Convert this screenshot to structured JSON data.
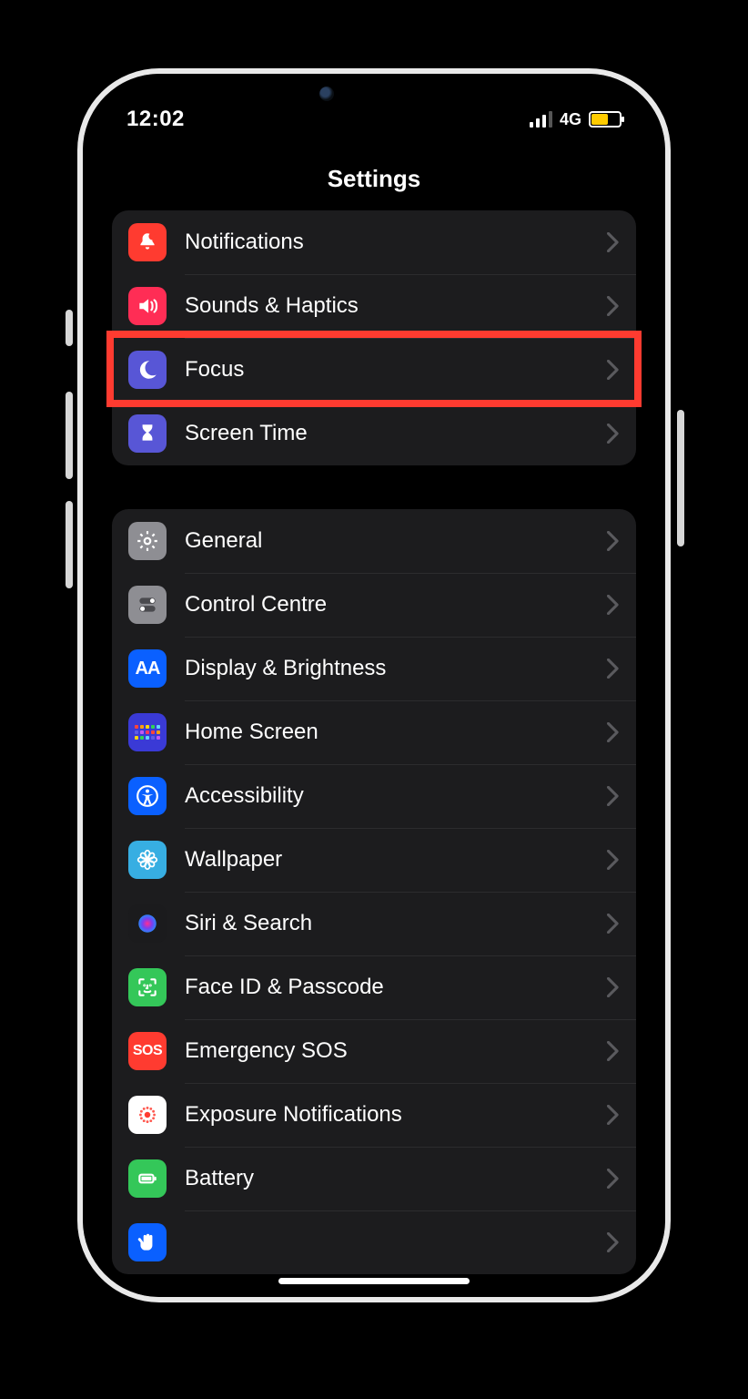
{
  "status": {
    "time": "12:02",
    "network": "4G"
  },
  "title": "Settings",
  "highlighted_index": [
    0,
    2
  ],
  "groups": [
    {
      "rows": [
        {
          "id": "notifications",
          "label": "Notifications",
          "icon": "bell-icon",
          "bg": "#ff3b30"
        },
        {
          "id": "sounds",
          "label": "Sounds & Haptics",
          "icon": "speaker-icon",
          "bg": "#ff2d55"
        },
        {
          "id": "focus",
          "label": "Focus",
          "icon": "moon-icon",
          "bg": "#5856d6"
        },
        {
          "id": "screentime",
          "label": "Screen Time",
          "icon": "hourglass-icon",
          "bg": "#5856d6"
        }
      ]
    },
    {
      "rows": [
        {
          "id": "general",
          "label": "General",
          "icon": "gear-icon",
          "bg": "#8e8e93"
        },
        {
          "id": "controlcentre",
          "label": "Control Centre",
          "icon": "switches-icon",
          "bg": "#8e8e93"
        },
        {
          "id": "display",
          "label": "Display & Brightness",
          "icon": "textsize-icon",
          "bg": "#0a60ff"
        },
        {
          "id": "homescreen",
          "label": "Home Screen",
          "icon": "apps-grid-icon",
          "bg": "#3a3ad6"
        },
        {
          "id": "accessibility",
          "label": "Accessibility",
          "icon": "accessibility-icon",
          "bg": "#0a60ff"
        },
        {
          "id": "wallpaper",
          "label": "Wallpaper",
          "icon": "flower-icon",
          "bg": "#37aee2"
        },
        {
          "id": "siri",
          "label": "Siri & Search",
          "icon": "siri-icon",
          "bg": "#1b1b1d"
        },
        {
          "id": "faceid",
          "label": "Face ID & Passcode",
          "icon": "faceid-icon",
          "bg": "#34c759"
        },
        {
          "id": "sos",
          "label": "Emergency SOS",
          "icon": "sos-icon",
          "bg": "#ff3b30"
        },
        {
          "id": "exposure",
          "label": "Exposure Notifications",
          "icon": "exposure-icon",
          "bg": "#ffffff"
        },
        {
          "id": "battery",
          "label": "Battery",
          "icon": "battery-icon",
          "bg": "#34c759"
        },
        {
          "id": "privacy",
          "label": "",
          "icon": "hand-icon",
          "bg": "#0a60ff"
        }
      ]
    }
  ]
}
